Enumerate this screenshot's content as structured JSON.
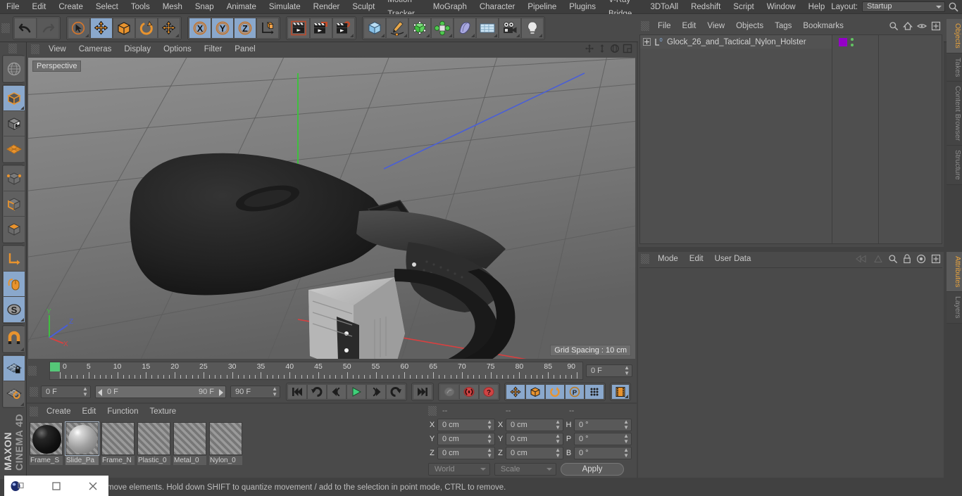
{
  "app": {
    "title": "MAXON CINEMA 4D",
    "brand_top": "MAXON",
    "brand_bottom": "CINEMA 4D"
  },
  "menubar": {
    "items": [
      "File",
      "Edit",
      "Create",
      "Select",
      "Tools",
      "Mesh",
      "Snap",
      "Animate",
      "Simulate",
      "Render",
      "Sculpt",
      "Motion Tracker",
      "MoGraph",
      "Character",
      "Pipeline",
      "Plugins",
      "V-Ray Bridge",
      "3DToAll",
      "Redshift",
      "Script",
      "Window",
      "Help"
    ],
    "layout_label": "Layout:",
    "layout_value": "Startup",
    "search_icon": "search-icon"
  },
  "toolbar": {
    "groups": [
      {
        "name": "undo-redo",
        "buttons": [
          {
            "name": "undo-button",
            "icon": "undo-arrow-icon",
            "state": "normal"
          },
          {
            "name": "redo-button",
            "icon": "redo-arrow-icon",
            "state": "disabled"
          }
        ]
      },
      {
        "name": "transform-tools",
        "buttons": [
          {
            "name": "live-selection-tool",
            "icon": "cursor-circle-icon",
            "state": "normal"
          },
          {
            "name": "move-tool",
            "icon": "move-arrows-icon",
            "state": "active"
          },
          {
            "name": "scale-tool",
            "icon": "scale-box-icon",
            "state": "normal"
          },
          {
            "name": "rotate-tool",
            "icon": "rotate-arc-icon",
            "state": "normal"
          },
          {
            "name": "move-dynamic-tool",
            "icon": "move-arrows-icon",
            "state": "normal"
          }
        ]
      },
      {
        "name": "axis-locks",
        "buttons": [
          {
            "name": "lock-x-axis-button",
            "icon": "x-axis-icon",
            "state": "active"
          },
          {
            "name": "lock-y-axis-button",
            "icon": "y-axis-icon",
            "state": "active"
          },
          {
            "name": "lock-z-axis-button",
            "icon": "z-axis-icon",
            "state": "active"
          },
          {
            "name": "world-object-coordinate-button",
            "icon": "coordinate-cube-icon",
            "state": "normal"
          }
        ]
      },
      {
        "name": "render-tools",
        "buttons": [
          {
            "name": "render-view-button",
            "icon": "render-clapper-icon",
            "state": "normal"
          },
          {
            "name": "render-to-picture-viewer-button",
            "icon": "render-picture-icon",
            "state": "normal"
          },
          {
            "name": "render-settings-button",
            "icon": "render-gear-icon",
            "state": "normal"
          }
        ]
      },
      {
        "name": "create-tools",
        "buttons": [
          {
            "name": "add-cube-button",
            "icon": "cube-icon",
            "state": "normal"
          },
          {
            "name": "add-spline-button",
            "icon": "pen-spline-icon",
            "state": "normal"
          },
          {
            "name": "add-generator-button",
            "icon": "generator-cube-icon",
            "state": "normal"
          },
          {
            "name": "add-array-button",
            "icon": "array-icon",
            "state": "normal"
          },
          {
            "name": "add-deformer-button",
            "icon": "bend-deformer-icon",
            "state": "normal"
          },
          {
            "name": "add-scene-object-button",
            "icon": "floor-grid-icon",
            "state": "normal"
          },
          {
            "name": "add-camera-button",
            "icon": "camera-icon",
            "state": "normal"
          },
          {
            "name": "add-light-button",
            "icon": "light-bulb-icon",
            "state": "normal"
          }
        ]
      }
    ]
  },
  "lefttools": {
    "groups": [
      [
        {
          "name": "viewport-undo-button",
          "icon": "globe-wire-icon",
          "state": "normal"
        }
      ],
      [
        {
          "name": "model-mode-button",
          "icon": "model-cube-icon",
          "state": "active"
        },
        {
          "name": "texture-mode-button",
          "icon": "texture-cube-icon",
          "state": "normal"
        },
        {
          "name": "workplane-mode-button",
          "icon": "workplane-icon",
          "state": "normal"
        }
      ],
      [
        {
          "name": "points-mode-button",
          "icon": "points-cube-icon",
          "state": "normal"
        },
        {
          "name": "edges-mode-button",
          "icon": "edges-cube-icon",
          "state": "normal"
        },
        {
          "name": "polygons-mode-button",
          "icon": "polygons-cube-icon",
          "state": "normal"
        }
      ],
      [
        {
          "name": "object-axis-mode-button",
          "icon": "axis-l-icon",
          "state": "normal"
        },
        {
          "name": "enable-axis-modification-button",
          "icon": "mouse-axis-icon",
          "state": "active"
        },
        {
          "name": "soft-selection-button",
          "icon": "s-circle-icon",
          "state": "active"
        }
      ],
      [
        {
          "name": "enable-snapping-button",
          "icon": "magnet-icon",
          "state": "normal"
        }
      ],
      [
        {
          "name": "lock-workplane-button",
          "icon": "workplane-lock-icon",
          "state": "active"
        },
        {
          "name": "planar-workplane-button",
          "icon": "workplane-rotate-icon",
          "state": "normal"
        }
      ]
    ]
  },
  "viewport": {
    "menu": [
      "View",
      "Cameras",
      "Display",
      "Options",
      "Filter",
      "Panel"
    ],
    "label": "Perspective",
    "grid_spacing": "Grid Spacing : 10 cm",
    "axis_labels": {
      "x": "X",
      "y": "Y",
      "z": "Z"
    },
    "nav_icons": [
      "pan-icon",
      "dolly-icon",
      "orbit-icon",
      "maximize-viewport-icon"
    ],
    "axis_colors": {
      "x": "#d94040",
      "y": "#3fbf3f",
      "z": "#4a5fd6"
    }
  },
  "timeline": {
    "start_frame_marker": "0",
    "ticks": [
      "0",
      "5",
      "10",
      "15",
      "20",
      "25",
      "30",
      "35",
      "40",
      "45",
      "50",
      "55",
      "60",
      "65",
      "70",
      "75",
      "80",
      "85",
      "90"
    ],
    "current_frame_field": "0 F"
  },
  "transport": {
    "current_frame": "0 F",
    "range_start": "0 F",
    "range_end": "90 F",
    "end_frame": "90 F",
    "buttons": [
      {
        "name": "go-to-start-button",
        "icon": "skip-start-icon"
      },
      {
        "name": "play-reverse-button",
        "icon": "play-reverse-icon"
      },
      {
        "name": "previous-frame-button",
        "icon": "step-back-icon"
      },
      {
        "name": "play-forward-button",
        "icon": "play-icon"
      },
      {
        "name": "next-frame-button",
        "icon": "step-forward-icon"
      },
      {
        "name": "play-loop-button",
        "icon": "loop-icon"
      },
      {
        "name": "go-to-end-button",
        "icon": "skip-end-icon"
      }
    ],
    "key_buttons": [
      {
        "name": "record-active-objects-button",
        "icon": "key-disabled-icon"
      },
      {
        "name": "autokeying-button",
        "icon": "autokey-icon"
      },
      {
        "name": "keyframe-selection-button",
        "icon": "key-question-icon"
      }
    ],
    "key_toggles": [
      {
        "name": "record-position-button",
        "icon": "position-arrows-icon",
        "state": "active"
      },
      {
        "name": "record-scale-button",
        "icon": "scale-box-icon",
        "state": "active"
      },
      {
        "name": "record-rotation-button",
        "icon": "rotate-arc-icon",
        "state": "active"
      },
      {
        "name": "record-pla-button",
        "icon": "pla-icon",
        "state": "active"
      },
      {
        "name": "record-parameter-button",
        "icon": "dots-grid-icon",
        "state": "active"
      }
    ],
    "timeline_toggle": {
      "name": "timeline-filmstrip-button",
      "icon": "filmstrip-icon",
      "state": "active"
    }
  },
  "materials": {
    "menu": [
      "Create",
      "Edit",
      "Function",
      "Texture"
    ],
    "items": [
      {
        "name": "Frame_S",
        "full": "Frame_S",
        "preview": "black-sphere",
        "selected": false
      },
      {
        "name": "Slide_Pa",
        "full": "Slide_Pa",
        "preview": "grey-sphere",
        "selected": true
      },
      {
        "name": "Frame_N",
        "full": "Frame_N",
        "preview": "none",
        "selected": false
      },
      {
        "name": "Plastic_0",
        "full": "Plastic_0",
        "preview": "none",
        "selected": false
      },
      {
        "name": "Metal_0",
        "full": "Metal_0",
        "preview": "none",
        "selected": false
      },
      {
        "name": "Nylon_0",
        "full": "Nylon_0",
        "preview": "none",
        "selected": false
      }
    ]
  },
  "coordinates": {
    "headers": [
      "--",
      "--",
      "--"
    ],
    "rows": [
      {
        "label1": "X",
        "value1": "0 cm",
        "label2": "X",
        "value2": "0 cm",
        "label3": "H",
        "value3": "0 °"
      },
      {
        "label1": "Y",
        "value1": "0 cm",
        "label2": "Y",
        "value2": "0 cm",
        "label3": "P",
        "value3": "0 °"
      },
      {
        "label1": "Z",
        "value1": "0 cm",
        "label2": "Z",
        "value2": "0 cm",
        "label3": "B",
        "value3": "0 °"
      }
    ],
    "system": "World",
    "mode": "Scale",
    "apply_label": "Apply"
  },
  "objects_panel": {
    "menu": [
      "File",
      "Edit",
      "View",
      "Objects",
      "Tags",
      "Bookmarks"
    ],
    "tools": [
      "search-icon",
      "home-icon",
      "eye-icon",
      "new-layout-icon"
    ],
    "rows": [
      {
        "name": "Glock_26_and_Tactical_Nylon_Holster",
        "level": "0",
        "tag_color": "#9400c8",
        "has_children": true
      }
    ]
  },
  "attributes_panel": {
    "menu": [
      "Mode",
      "Edit",
      "User Data"
    ],
    "tools": [
      "history-back-icon",
      "history-forward-icon",
      "search-icon",
      "lock-icon",
      "target-icon",
      "new-layout-icon"
    ]
  },
  "right_tabs": {
    "top": [
      "Objects",
      "Takes",
      "Content Browser",
      "Structure"
    ],
    "top_active": "Objects",
    "bottom": [
      "Attributes",
      "Layers"
    ],
    "bottom_active": "Attributes"
  },
  "statusbar": {
    "text": "move elements. Hold down SHIFT to quantize movement / add to the selection in point mode, CTRL to remove."
  },
  "window_controls": {
    "minimize": "minimize-icon",
    "maximize": "maximize-icon",
    "close": "close-icon"
  }
}
